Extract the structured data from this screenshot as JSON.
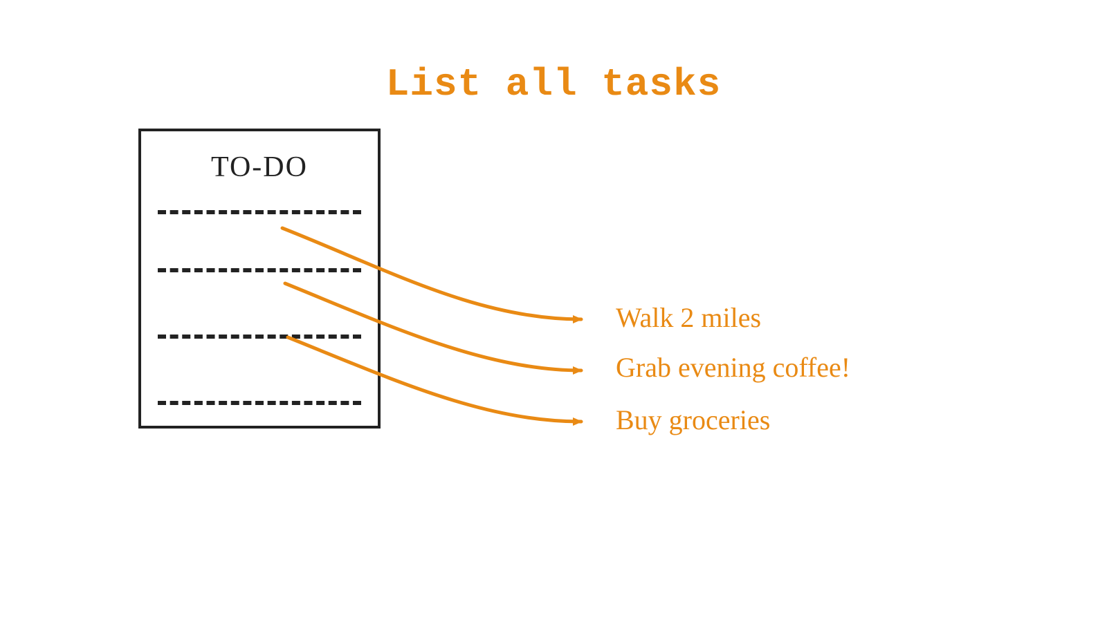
{
  "title": "List all tasks",
  "notepad": {
    "heading": "TO-DO"
  },
  "tasks": [
    "Walk 2 miles",
    "Grab evening coffee!",
    "Buy groceries"
  ],
  "colors": {
    "accent": "#e98a14",
    "ink": "#222222"
  }
}
